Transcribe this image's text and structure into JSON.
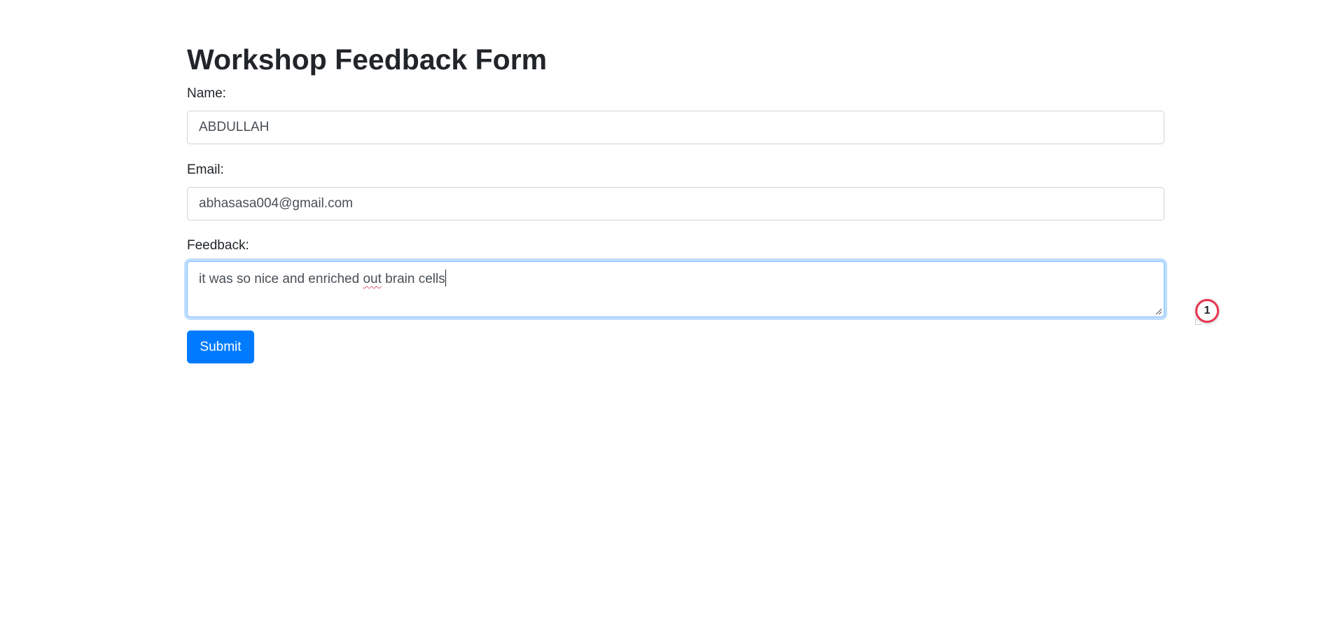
{
  "form": {
    "title": "Workshop Feedback Form",
    "name_label": "Name:",
    "name_value": "ABDULLAH",
    "email_label": "Email:",
    "email_value": "abhasasa004@gmail.com",
    "feedback_label": "Feedback:",
    "feedback_before": "it was so nice and enriched ",
    "feedback_misspelled": "out",
    "feedback_after": " brain cells",
    "submit_label": "Submit"
  },
  "overlay": {
    "badge_count": "1"
  },
  "colors": {
    "primary": "#007bff",
    "focus_border": "#80bdff",
    "badge_ring": "#e8334f",
    "text": "#212529"
  }
}
